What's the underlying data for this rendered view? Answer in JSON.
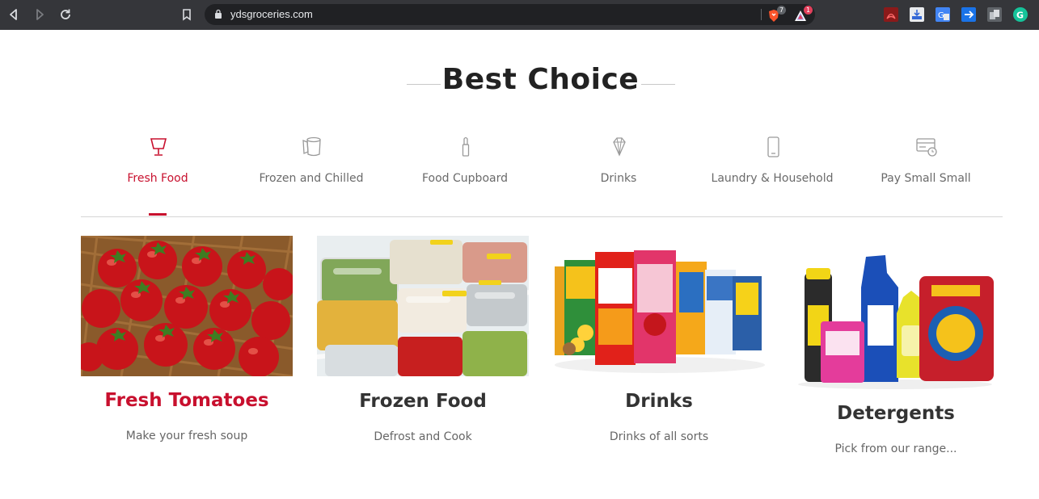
{
  "browser": {
    "url": "ydsgroceries.com",
    "brave_shield_count": "7",
    "brave_rewards_count": "1"
  },
  "page": {
    "heading": "Best Choice",
    "accent_color": "#c8102e"
  },
  "tabs": [
    {
      "label": "Fresh Food",
      "icon": "desk-lamp-icon",
      "active": true
    },
    {
      "label": "Frozen and Chilled",
      "icon": "cup-icon",
      "active": false
    },
    {
      "label": "Food Cupboard",
      "icon": "lipstick-icon",
      "active": false
    },
    {
      "label": "Drinks",
      "icon": "diamond-icon",
      "active": false
    },
    {
      "label": "Laundry & Household",
      "icon": "phone-icon",
      "active": false
    },
    {
      "label": "Pay Small Small",
      "icon": "credit-card-clock-icon",
      "active": false
    }
  ],
  "cards": [
    {
      "title": "Fresh Tomatoes",
      "description": "Make your fresh soup",
      "image": "tomatoes-basket-image"
    },
    {
      "title": "Frozen Food",
      "description": "Defrost and Cook",
      "image": "frozen-food-fridge-image"
    },
    {
      "title": "Drinks",
      "description": "Drinks of all sorts",
      "image": "juice-cartons-image"
    },
    {
      "title": "Detergents",
      "description": "Pick from our range...",
      "image": "detergent-products-image"
    }
  ]
}
